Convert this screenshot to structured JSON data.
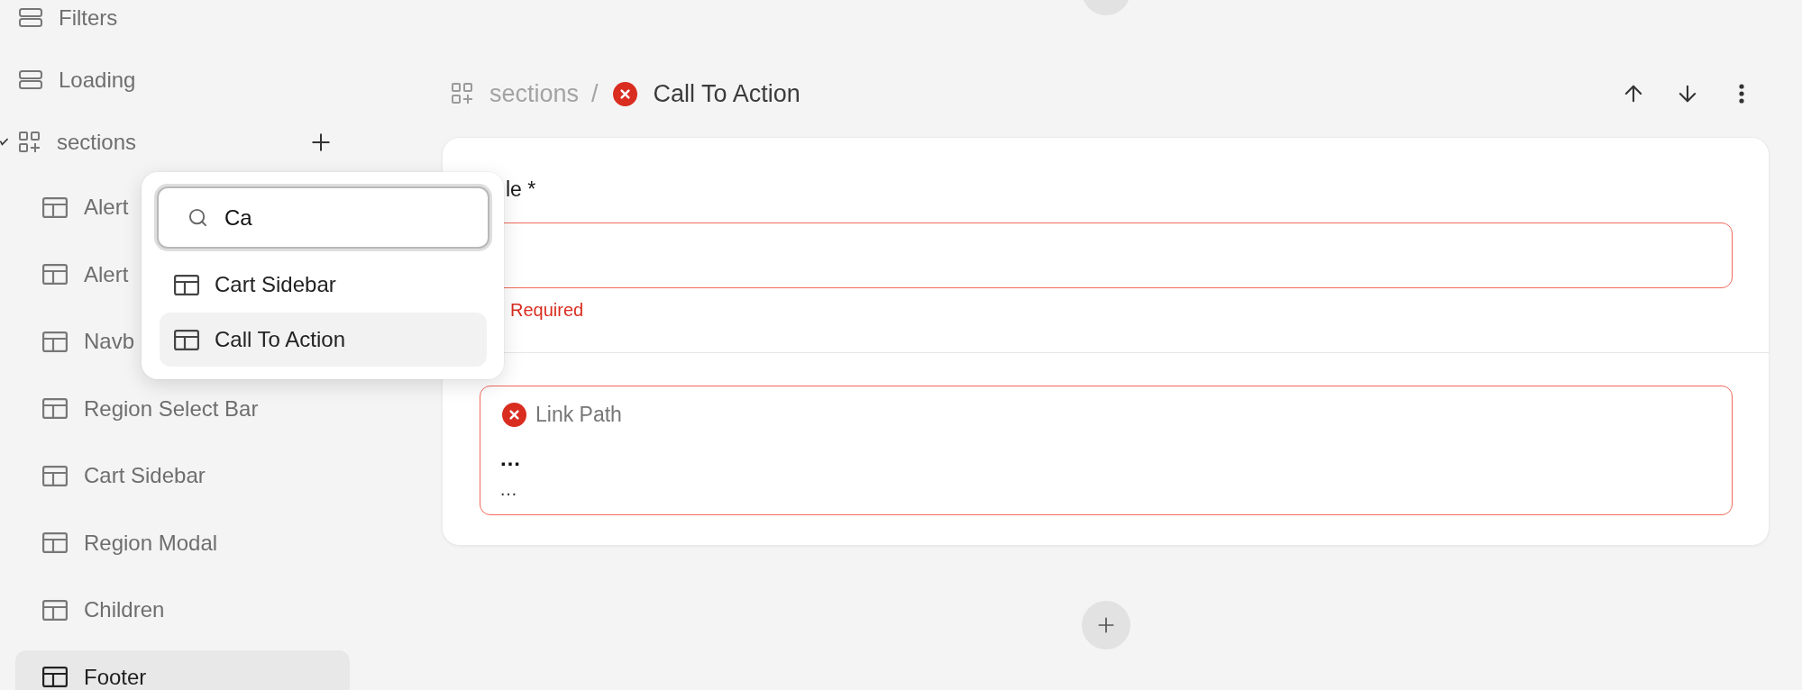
{
  "sidebar": {
    "items": [
      {
        "kind": "object",
        "label": "Filters",
        "selected": false
      },
      {
        "kind": "object",
        "label": "Loading",
        "selected": false
      },
      {
        "kind": "list",
        "label": "sections",
        "selected": false,
        "expanded": true,
        "children": [
          {
            "kind": "template",
            "label": "Alert",
            "selected": false
          },
          {
            "kind": "template",
            "label": "Alert",
            "selected": false
          },
          {
            "kind": "template",
            "label": "Navb",
            "selected": false
          },
          {
            "kind": "template",
            "label": "Region Select Bar",
            "selected": false
          },
          {
            "kind": "template",
            "label": "Cart Sidebar",
            "selected": false
          },
          {
            "kind": "template",
            "label": "Region Modal",
            "selected": false
          },
          {
            "kind": "template",
            "label": "Children",
            "selected": false
          },
          {
            "kind": "template",
            "label": "Footer",
            "selected": true
          }
        ]
      }
    ]
  },
  "add_menu": {
    "search": {
      "value": "Ca"
    },
    "options": [
      {
        "kind": "template",
        "label": "Cart Sidebar",
        "selected": false
      },
      {
        "kind": "template",
        "label": "Call To Action",
        "selected": true
      }
    ]
  },
  "breadcrumb": {
    "parent": "sections",
    "separator": "/",
    "current": "Call To Action",
    "invalid": true
  },
  "card": {
    "fields": [
      {
        "kind": "text",
        "label": "le *",
        "invalid": true,
        "message": "Required"
      },
      {
        "kind": "link",
        "label": "Link Path",
        "invalid": true,
        "lines": [
          {
            "kind": "primary",
            "text": "…"
          },
          {
            "kind": "secondary",
            "text": "…"
          }
        ]
      }
    ]
  }
}
